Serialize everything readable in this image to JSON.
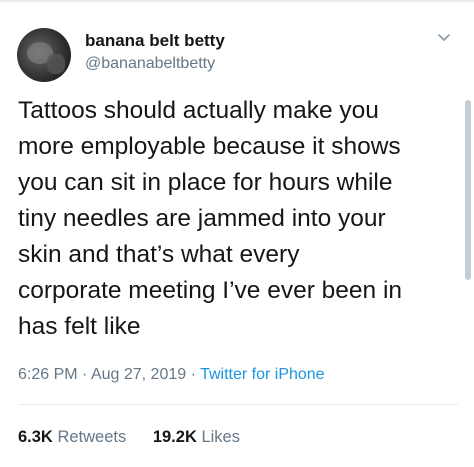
{
  "user": {
    "display_name": "banana belt betty",
    "handle": "@bananabeltbetty"
  },
  "tweet": {
    "lines": [
      "Tattoos should actually make you",
      "more employable because it shows",
      "you can sit in place for hours while",
      "tiny needles are jammed into your",
      "skin and that’s what every",
      "corporate meeting I’ve ever been in",
      "has felt like"
    ],
    "time": "6:26 PM",
    "date": "Aug 27, 2019",
    "separator": "·",
    "source": "Twitter for iPhone"
  },
  "stats": {
    "retweets_count": "6.3K",
    "retweets_label": "Retweets",
    "likes_count": "19.2K",
    "likes_label": "Likes"
  },
  "icons": {
    "menu": "chevron-down-icon"
  },
  "colors": {
    "text": "#14171a",
    "secondary": "#657786",
    "link": "#1b95e0"
  }
}
